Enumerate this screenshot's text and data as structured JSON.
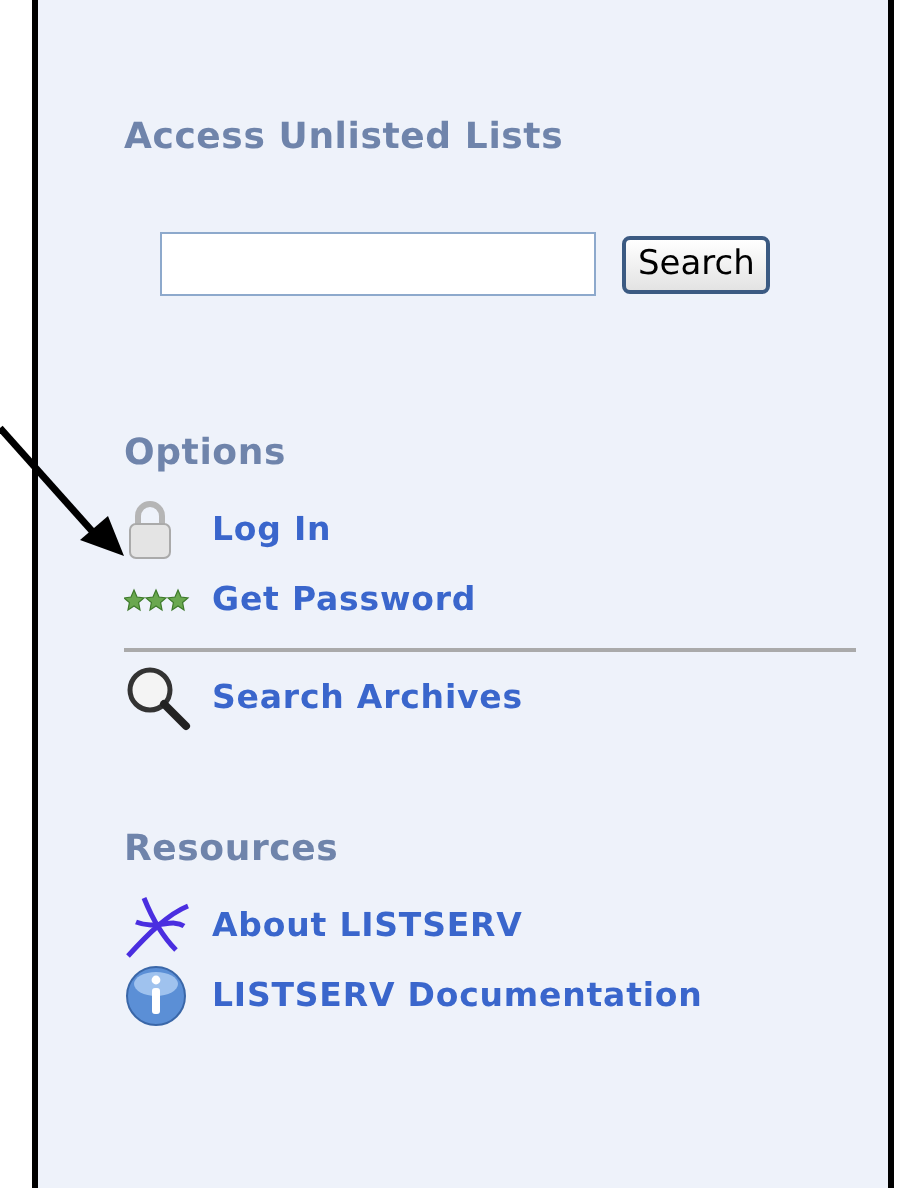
{
  "unlisted": {
    "heading": "Access Unlisted Lists",
    "button": "Search"
  },
  "options": {
    "heading": "Options",
    "groups": [
      [
        {
          "kind": "lock",
          "label": "Log In"
        },
        {
          "kind": "stars",
          "label": "Get Password"
        }
      ],
      [
        {
          "kind": "magnifier",
          "label": "Search Archives"
        }
      ]
    ]
  },
  "resources": {
    "heading": "Resources",
    "groups": [
      [
        {
          "kind": "logo",
          "label": "About LISTSERV"
        },
        {
          "kind": "info",
          "label": "LISTSERV Documentation"
        }
      ]
    ]
  }
}
